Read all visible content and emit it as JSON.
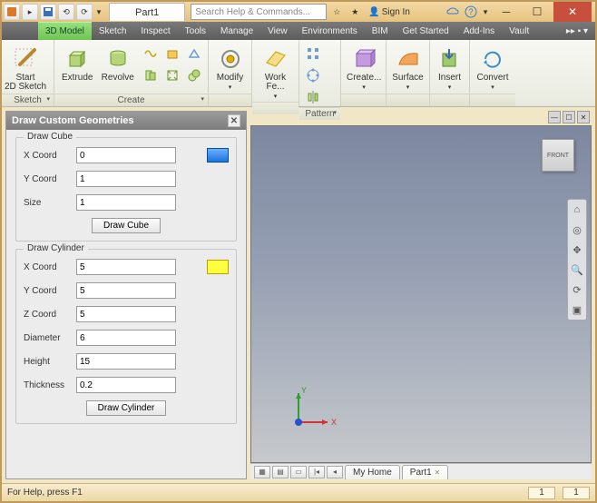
{
  "titlebar": {
    "doc_title": "Part1",
    "search_placeholder": "Search Help & Commands...",
    "signin": "Sign In"
  },
  "ribbon_tabs": [
    "3D Model",
    "Sketch",
    "Inspect",
    "Tools",
    "Manage",
    "View",
    "Environments",
    "BIM",
    "Get Started",
    "Add-Ins",
    "Vault"
  ],
  "ribbon": {
    "sketch": {
      "title": "Sketch",
      "start": "Start\n2D Sketch"
    },
    "create": {
      "title": "Create",
      "extrude": "Extrude",
      "revolve": "Revolve"
    },
    "modify": {
      "title": "",
      "label": "Modify"
    },
    "workfe": {
      "label": "Work Fe..."
    },
    "pattern": {
      "title": "Pattern"
    },
    "createp": {
      "label": "Create..."
    },
    "surface": {
      "label": "Surface"
    },
    "insert": {
      "label": "Insert"
    },
    "convert": {
      "label": "Convert"
    }
  },
  "side_panel": {
    "title": "Draw Custom Geometries",
    "cube": {
      "legend": "Draw Cube",
      "x_label": "X Coord",
      "x": "0",
      "y_label": "Y Coord",
      "y": "1",
      "size_label": "Size",
      "size": "1",
      "button": "Draw Cube"
    },
    "cyl": {
      "legend": "Draw Cylinder",
      "x_label": "X Coord",
      "x": "5",
      "y_label": "Y Coord",
      "y": "5",
      "z_label": "Z Coord",
      "z": "5",
      "d_label": "Diameter",
      "d": "6",
      "h_label": "Height",
      "h": "15",
      "t_label": "Thickness",
      "t": "0.2",
      "button": "Draw Cylinder"
    }
  },
  "viewport": {
    "cube_face": "FRONT",
    "axes": {
      "x": "X",
      "y": "Y"
    }
  },
  "doc_tabs": {
    "home": "My Home",
    "part": "Part1"
  },
  "status": {
    "help": "For Help, press F1",
    "c1": "1",
    "c2": "1"
  }
}
